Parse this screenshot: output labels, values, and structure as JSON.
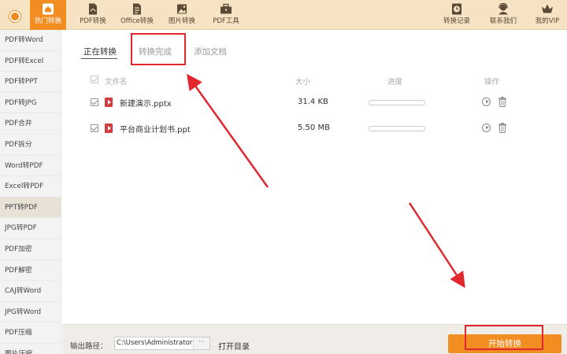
{
  "topnav": {
    "items": [
      {
        "label": "热门转换",
        "icon": "home-icon"
      },
      {
        "label": "PDF转换",
        "icon": "pdf-file-icon"
      },
      {
        "label": "Office转换",
        "icon": "office-doc-icon"
      },
      {
        "label": "图片转换",
        "icon": "image-icon"
      },
      {
        "label": "PDF工具",
        "icon": "toolbox-icon"
      }
    ],
    "right_items": [
      {
        "label": "转换记录",
        "icon": "history-clock-icon"
      },
      {
        "label": "联系我们",
        "icon": "customer-service-icon"
      },
      {
        "label": "我的VIP",
        "icon": "crown-icon"
      }
    ],
    "active_color": "#f28d22",
    "bar_color": "#f6e3c4"
  },
  "sidebar": {
    "items": [
      "PDF转Word",
      "PDF转Excel",
      "PDF转PPT",
      "PDF转JPG",
      "PDF合并",
      "PDF拆分",
      "Word转PDF",
      "Excel转PDF",
      "PPT转PDF",
      "JPG转PDF",
      "PDF加密",
      "PDF解密",
      "CAJ转Word",
      "JPG转Word",
      "PDF压缩",
      "图片压缩"
    ],
    "active_index": 8
  },
  "tabs": [
    "正在转换",
    "转换完成",
    "添加文档"
  ],
  "table": {
    "headers": {
      "name": "文件名",
      "size": "大小",
      "progress": "进度",
      "action": "操作"
    },
    "rows": [
      {
        "name": "新建演示.pptx",
        "size": "31.4 KB",
        "progress": 0
      },
      {
        "name": "平台商业计划书.ppt",
        "size": "5.50 MB",
        "progress": 0
      }
    ]
  },
  "bottom": {
    "output_label": "输出路径：",
    "output_path": "C:\\Users\\Administrator",
    "more": "···",
    "open_dir": "打开目录",
    "start": "开始转换"
  },
  "annotation_color": "#e0282e"
}
